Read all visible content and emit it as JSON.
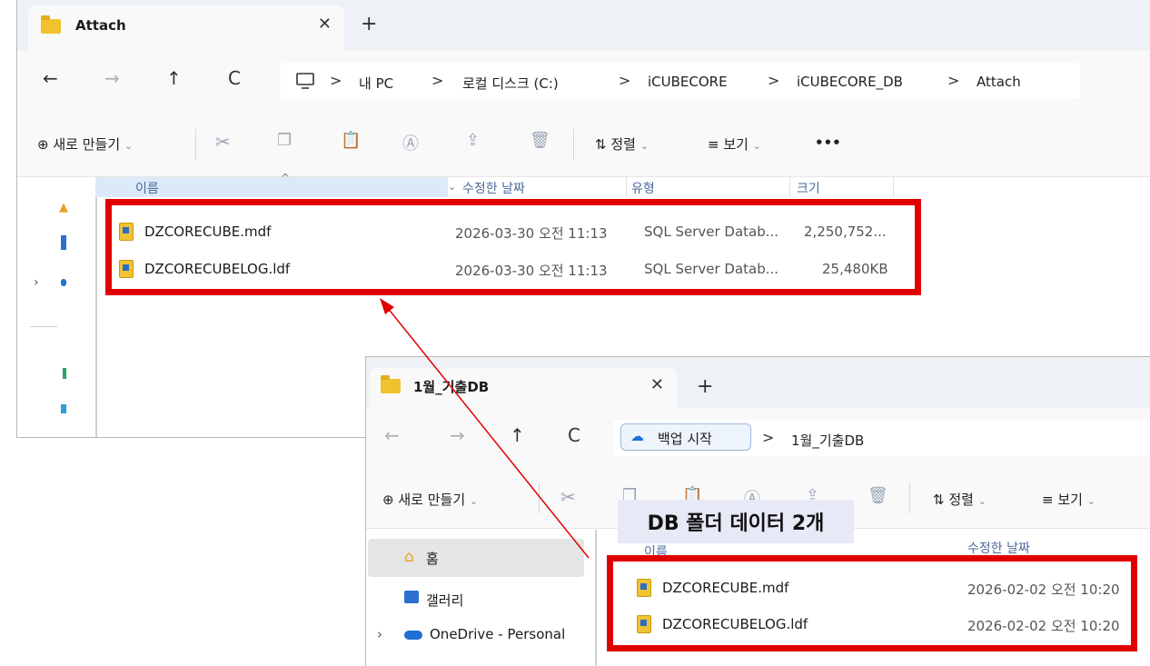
{
  "window1": {
    "tab_title": "Attach",
    "tab_close": "✕",
    "new_tab": "+",
    "nav": {
      "back": "←",
      "forward": "→",
      "up": "↑",
      "refresh": "C"
    },
    "breadcrumb": [
      "내 PC",
      "로컬 디스크 (C:)",
      "iCUBECORE",
      "iCUBECORE_DB",
      "Attach"
    ],
    "toolbar": {
      "new_label": "새로 만들기",
      "sort_label": "정렬",
      "view_label": "보기",
      "more": "•••"
    },
    "columns": {
      "name": "이름",
      "date": "수정한 날짜",
      "type": "유형",
      "size": "크기"
    },
    "files": [
      {
        "name": "DZCORECUBE.mdf",
        "date": "2026-03-30 오전 11:13",
        "type": "SQL Server Datab...",
        "size": "2,250,752..."
      },
      {
        "name": "DZCORECUBELOG.ldf",
        "date": "2026-03-30 오전 11:13",
        "type": "SQL Server Datab...",
        "size": "25,480KB"
      }
    ]
  },
  "window2": {
    "tab_title": "1월_기출DB",
    "tab_close": "✕",
    "new_tab": "+",
    "nav": {
      "back": "←",
      "forward": "→",
      "up": "↑",
      "refresh": "C"
    },
    "backup_label": "백업 시작",
    "breadcrumb": [
      "1월_기출DB"
    ],
    "toolbar": {
      "new_label": "새로 만들기",
      "sort_label": "정렬",
      "view_label": "보기"
    },
    "sidebar": [
      {
        "label": "홈",
        "icon": "home-icon"
      },
      {
        "label": "갤러리",
        "icon": "gallery-icon"
      },
      {
        "label": "OneDrive - Personal",
        "icon": "onedrive-icon"
      }
    ],
    "columns": {
      "name": "이름",
      "date": "수정한 날짜"
    },
    "files": [
      {
        "name": "DZCORECUBE.mdf",
        "date": "2026-02-02 오전 10:20"
      },
      {
        "name": "DZCORECUBELOG.ldf",
        "date": "2026-02-02 오전 10:20"
      }
    ]
  },
  "annotation": {
    "label": "DB 폴더 데이터 2개",
    "color": "#e00000"
  }
}
